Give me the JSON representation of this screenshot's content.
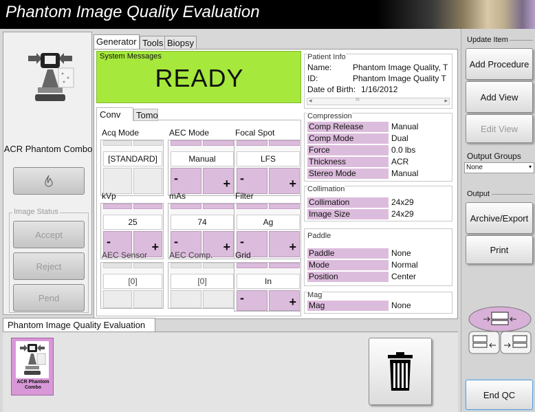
{
  "app": {
    "title": "Phantom Image Quality Evaluation"
  },
  "left": {
    "procedure_name": "ACR Phantom Combo",
    "image_status_label": "Image Status",
    "accept": "Accept",
    "reject": "Reject",
    "pend": "Pend"
  },
  "tabs": {
    "generator": "Generator",
    "tools": "Tools",
    "biopsy": "Biopsy"
  },
  "system_messages": {
    "label": "System Messages",
    "status": "READY",
    "color": "#a6e83c"
  },
  "subtabs": {
    "conv": "Conv",
    "tomo": "Tomo"
  },
  "controls": {
    "acq_mode": {
      "label": "Acq Mode",
      "value": "[STANDARD]"
    },
    "aec_mode": {
      "label": "AEC Mode",
      "value": "Manual"
    },
    "focal_spot": {
      "label": "Focal Spot",
      "value": "LFS"
    },
    "kvp": {
      "label": "kVp",
      "value": "25"
    },
    "mas": {
      "label": "mAs",
      "value": "74"
    },
    "filter": {
      "label": "Filter",
      "value": "Ag"
    },
    "aec_sensor": {
      "label": "AEC Sensor",
      "value": "[0]"
    },
    "aec_comp": {
      "label": "AEC Comp.",
      "value": "[0]"
    },
    "grid": {
      "label": "Grid",
      "value": "In"
    },
    "minus": "-",
    "plus": "+"
  },
  "patient_info": {
    "label": "Patient Info",
    "name_label": "Name:",
    "name_value": "Phantom Image Quality, T",
    "id_label": "ID:",
    "id_value": "Phantom Image Quality T",
    "dob_label": "Date of Birth:",
    "dob_value": "1/16/2012",
    "scroll_grip": "III"
  },
  "compression": {
    "label": "Compression",
    "rows": [
      {
        "k": "Comp Release",
        "v": "Manual"
      },
      {
        "k": "Comp Mode",
        "v": "Dual"
      },
      {
        "k": "Force",
        "v": "0.0 lbs"
      },
      {
        "k": "Thickness",
        "v": "ACR"
      },
      {
        "k": "Stereo Mode",
        "v": "Manual"
      }
    ]
  },
  "collimation": {
    "label": "Collimation",
    "rows": [
      {
        "k": "Collimation",
        "v": "24x29"
      },
      {
        "k": "Image Size",
        "v": "24x29"
      }
    ]
  },
  "paddle": {
    "label": "Paddle",
    "rows": [
      {
        "k": "Paddle",
        "v": "None"
      },
      {
        "k": "Mode",
        "v": "Normal"
      },
      {
        "k": "Position",
        "v": "Center"
      }
    ]
  },
  "mag": {
    "label": "Mag",
    "rows": [
      {
        "k": "Mag",
        "v": "None"
      }
    ]
  },
  "right": {
    "update_item": "Update Item",
    "add_procedure": "Add Procedure",
    "add_view": "Add View",
    "edit_view": "Edit View",
    "output_groups": "Output Groups",
    "output_groups_value": "None",
    "output": "Output",
    "archive_export": "Archive/Export",
    "print": "Print",
    "end_qc": "End QC"
  },
  "bottom": {
    "tab": "Phantom Image Quality Evaluation",
    "thumb_label_1": "ACR Phantom",
    "thumb_label_2": "Combo"
  }
}
